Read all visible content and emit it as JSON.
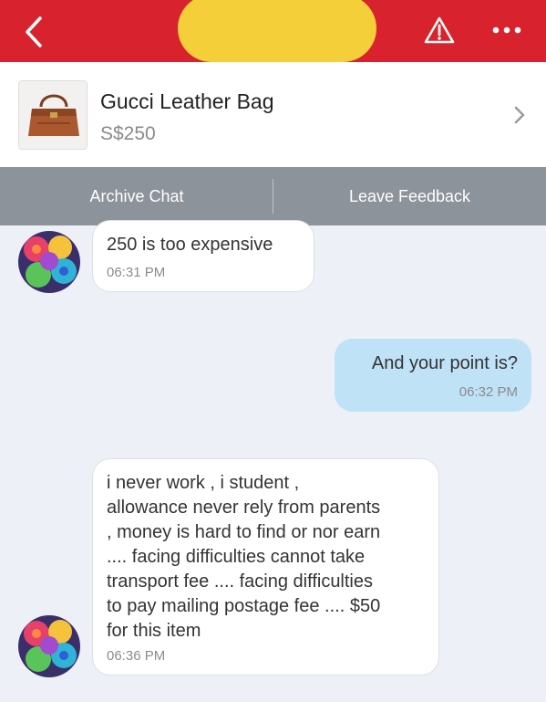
{
  "header": {
    "back_icon": "chevron-left-icon",
    "warning_icon": "warning-triangle-icon",
    "more_icon": "more-dots-icon",
    "colors": {
      "bar": "#d8232f",
      "redaction": "#f5cf3a"
    }
  },
  "listing": {
    "title": "Gucci Leather Bag",
    "price": "S$250"
  },
  "actions": {
    "archive_label": "Archive Chat",
    "feedback_label": "Leave Feedback"
  },
  "messages": [
    {
      "side": "incoming",
      "text": "250 is too expensive",
      "time": "06:31 PM"
    },
    {
      "side": "outgoing",
      "text": "And your point is?",
      "time": "06:32 PM"
    },
    {
      "side": "incoming",
      "lines": [
        "i never work , i student ,",
        "allowance never rely from parents",
        ", money is hard to find or nor earn",
        ".... facing difficulties cannot take",
        "transport fee .... facing difficulties",
        "to pay mailing postage fee .... $50",
        "for this item"
      ],
      "time": "06:36 PM"
    }
  ]
}
